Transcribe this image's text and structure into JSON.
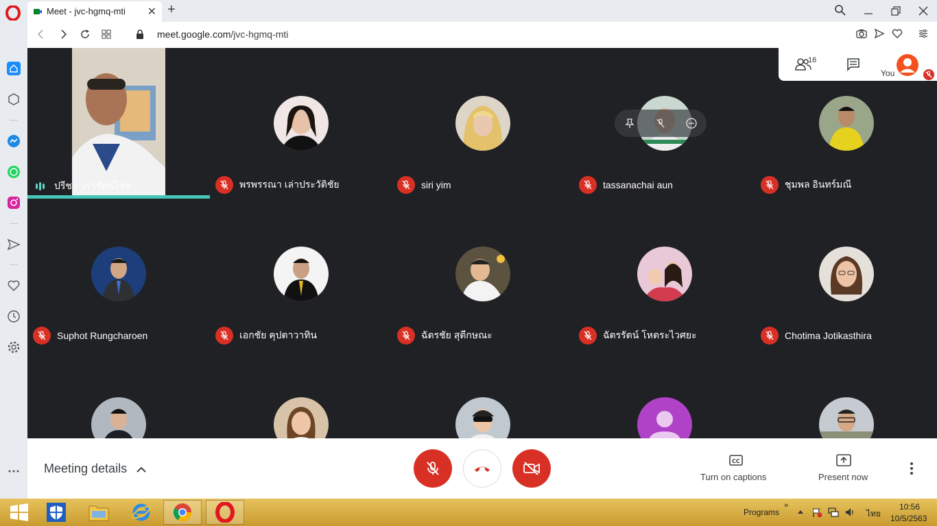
{
  "browser": {
    "tab_title": "Meet - jvc-hgmq-mti",
    "url_host": "meet.google.com",
    "url_path": "/jvc-hgmq-mti",
    "new_tab": "+",
    "tab_close": "✕"
  },
  "meet": {
    "people_count": "16",
    "you_label": "You",
    "speaker_name": "ปรีชา วรารัตน์ไชย",
    "participants_row1": [
      {
        "name": "พรพรรณา เล่าประวัติชัย"
      },
      {
        "name": "siri yim"
      },
      {
        "name": "tassanachai aun"
      },
      {
        "name": "ชุมพล อินทร์มณี"
      }
    ],
    "participants_row2": [
      {
        "name": "Suphot Rungcharoen"
      },
      {
        "name": "เอกชัย คุปตาวาทิน"
      },
      {
        "name": "ฉัตรชัย สุตีกษณะ"
      },
      {
        "name": "ฉัตรรัตน์ โหตระไวศยะ"
      },
      {
        "name": "Chotima Jotikasthira"
      }
    ]
  },
  "controls": {
    "meeting_details": "Meeting details",
    "captions": "Turn on captions",
    "present": "Present now"
  },
  "taskbar": {
    "programs": "Programs",
    "chevrons": "»",
    "lang": "ไทย",
    "time": "10:56",
    "date": "10/5/2563"
  },
  "colors": {
    "stage": "#202124",
    "mic_off": "#d93025",
    "speaking": "#44c7b8"
  }
}
